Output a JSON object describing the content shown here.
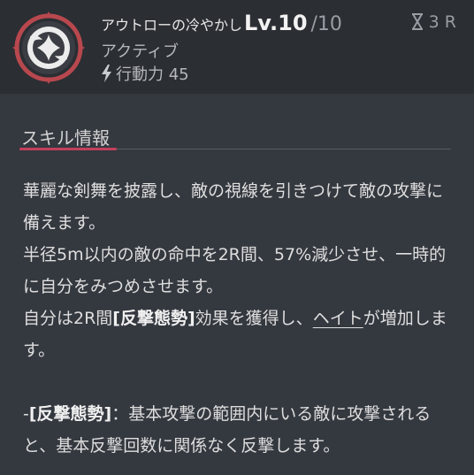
{
  "skill": {
    "name": "アウトローの冷やかし",
    "level": "Lv.10",
    "level_max": "/10",
    "type": "アクティブ",
    "action_point": "行動力 45",
    "cooldown": "3 R",
    "icon": "outlaw-emblem-icon"
  },
  "section": {
    "title": "スキル情報"
  },
  "description": {
    "line1": "華麗な剣舞を披露し、敵の視線を引きつけて敵の攻撃に備えます。",
    "line2": "半径5m以内の敵の命中を2R間、57%減少させ、一時的に自分をみつめさせます。",
    "line3_pre": "自分は2R間",
    "line3_kw": "[反撃態勢]",
    "line3_mid": "効果を獲得し、",
    "line3_link": "ヘイト",
    "line3_post": "が増加します。",
    "line4_dash": "-",
    "line4_kw": "[反撃態勢]",
    "line4_text": "：基本攻撃の範囲内にいる敵に攻撃されると、基本反撃回数に関係なく反撃します。"
  },
  "colors": {
    "accent": "#c2405b",
    "icon_ring": "#b8484e",
    "background": "#34383f",
    "header": "#2b2e33"
  }
}
